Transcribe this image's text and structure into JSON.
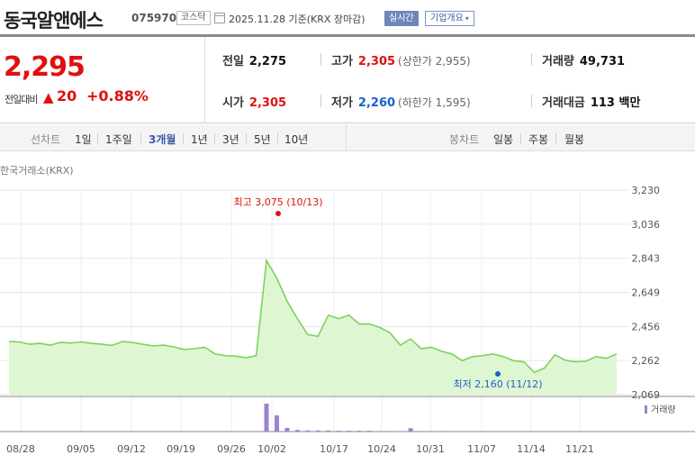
{
  "header": {
    "stock_name": "동국알앤에스",
    "stock_code": "075970",
    "market_badge": "코스닥",
    "date_text": "2025.11.28  기준(KRX 장마감)",
    "realtime_label": "실시간",
    "company_info_label": "기업개요",
    "caret": "▾"
  },
  "summary": {
    "price": "2,295",
    "change_label": "전일대비",
    "change_arrow": "▲",
    "change_value": "20",
    "change_pct": "+0.88%",
    "prev_close_label": "전일",
    "prev_close": "2,275",
    "high_label": "고가",
    "high": "2,305",
    "upper_limit": "(상한가 2,955)",
    "volume_label": "거래량",
    "volume": "49,731",
    "open_label": "시가",
    "open": "2,305",
    "low_label": "저가",
    "low": "2,260",
    "lower_limit": "(하한가 1,595)",
    "amount_label": "거래대금",
    "amount": "113 백만"
  },
  "toolbar": {
    "line_chart_label": "선차트",
    "periods": [
      "1일",
      "1주일",
      "3개월",
      "1년",
      "3년",
      "5년",
      "10년"
    ],
    "active_period": "3개월",
    "candle_chart_label": "봉차트",
    "candle_periods": [
      "일봉",
      "주봉",
      "월봉"
    ]
  },
  "exchange_label": "한국거래소(KRX)",
  "colors": {
    "up": "#e01010",
    "down": "#1a5fcc",
    "line": "#7cd35a",
    "area": "#dff6d3",
    "volume_bar": "#9b84cf"
  },
  "chart_data": {
    "type": "area",
    "y_ticks": [
      "3,230",
      "3,036",
      "2,843",
      "2,649",
      "2,456",
      "2,262",
      "2,069"
    ],
    "ylim": [
      2069,
      3230
    ],
    "x_ticks": [
      "08/28",
      "09/05",
      "09/12",
      "09/19",
      "09/26",
      "10/02",
      "10/17",
      "10/24",
      "10/31",
      "11/07",
      "11/14",
      "11/21"
    ],
    "values": [
      2370,
      2368,
      2355,
      2360,
      2350,
      2365,
      2362,
      2368,
      2360,
      2355,
      2348,
      2370,
      2365,
      2355,
      2345,
      2350,
      2340,
      2325,
      2330,
      2338,
      2300,
      2290,
      2288,
      2278,
      2290,
      2830,
      2730,
      2600,
      2500,
      2410,
      2400,
      2520,
      2500,
      2520,
      2470,
      2470,
      2450,
      2420,
      2350,
      2385,
      2330,
      2338,
      2315,
      2300,
      2262,
      2285,
      2290,
      2300,
      2285,
      2262,
      2255,
      2195,
      2220,
      2295,
      2265,
      2255,
      2258,
      2285,
      2275,
      2300
    ],
    "high_annotation": "최고 3,075 (10/13)",
    "low_annotation": "최저 2,160 (11/12)",
    "volume_label": "거래량",
    "volume": [
      1,
      1,
      1,
      1,
      1,
      1,
      1,
      1,
      1,
      1,
      1,
      1,
      1,
      1,
      1,
      1,
      1,
      1,
      1,
      1,
      1,
      1,
      1,
      1,
      1,
      100,
      58,
      13,
      6,
      4,
      4,
      4,
      3,
      3,
      3,
      3,
      2,
      2,
      2,
      12,
      2,
      2,
      2,
      1,
      1,
      1,
      1,
      1,
      1,
      1,
      1,
      1,
      1,
      1,
      1,
      1,
      1,
      1,
      1,
      1
    ]
  }
}
